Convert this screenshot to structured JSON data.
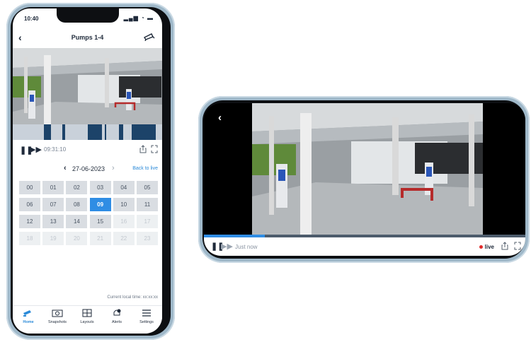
{
  "portrait": {
    "status": {
      "time": "10:40",
      "icons": "▂▄▆ ◔ ▬"
    },
    "nav": {
      "back_icon": "‹",
      "title": "Pumps 1-4",
      "camera_icon": "camera-icon"
    },
    "playback": {
      "time": "09:31:10",
      "pause_icon": "❚❚",
      "ff_icon": "▶▶"
    },
    "date": {
      "prev_icon": "‹",
      "value": "27-06-2023",
      "next_icon": "›",
      "back_to_live": "Back to live"
    },
    "hours": [
      {
        "label": "00",
        "state": "normal"
      },
      {
        "label": "01",
        "state": "normal"
      },
      {
        "label": "02",
        "state": "normal"
      },
      {
        "label": "03",
        "state": "normal"
      },
      {
        "label": "04",
        "state": "normal"
      },
      {
        "label": "05",
        "state": "normal"
      },
      {
        "label": "06",
        "state": "normal"
      },
      {
        "label": "07",
        "state": "normal"
      },
      {
        "label": "08",
        "state": "normal"
      },
      {
        "label": "09",
        "state": "selected"
      },
      {
        "label": "10",
        "state": "normal"
      },
      {
        "label": "11",
        "state": "normal"
      },
      {
        "label": "12",
        "state": "normal"
      },
      {
        "label": "13",
        "state": "normal"
      },
      {
        "label": "14",
        "state": "normal"
      },
      {
        "label": "15",
        "state": "normal"
      },
      {
        "label": "16",
        "state": "disabled"
      },
      {
        "label": "17",
        "state": "disabled"
      },
      {
        "label": "18",
        "state": "disabled"
      },
      {
        "label": "19",
        "state": "disabled"
      },
      {
        "label": "20",
        "state": "disabled"
      },
      {
        "label": "21",
        "state": "disabled"
      },
      {
        "label": "22",
        "state": "disabled"
      },
      {
        "label": "23",
        "state": "disabled"
      }
    ],
    "local_time": "Current local time: xx:xx:xx",
    "tabs": [
      {
        "label": "Home",
        "icon": "camera-icon",
        "active": true
      },
      {
        "label": "Snapshots",
        "icon": "snapshot-icon",
        "active": false
      },
      {
        "label": "Layouts",
        "icon": "layouts-icon",
        "active": false
      },
      {
        "label": "Alerts",
        "icon": "alerts-icon",
        "active": false
      },
      {
        "label": "Settings",
        "icon": "menu-icon",
        "active": false
      }
    ]
  },
  "landscape": {
    "back_icon": "‹",
    "pause_icon": "❚❚",
    "ff_icon": "▶▶",
    "status": "Just now",
    "live": "live",
    "progress_fraction": 0.19
  },
  "colors": {
    "accent": "#2f8de4",
    "timeline_dark": "#1c4369",
    "live_red": "#e02a2a"
  }
}
